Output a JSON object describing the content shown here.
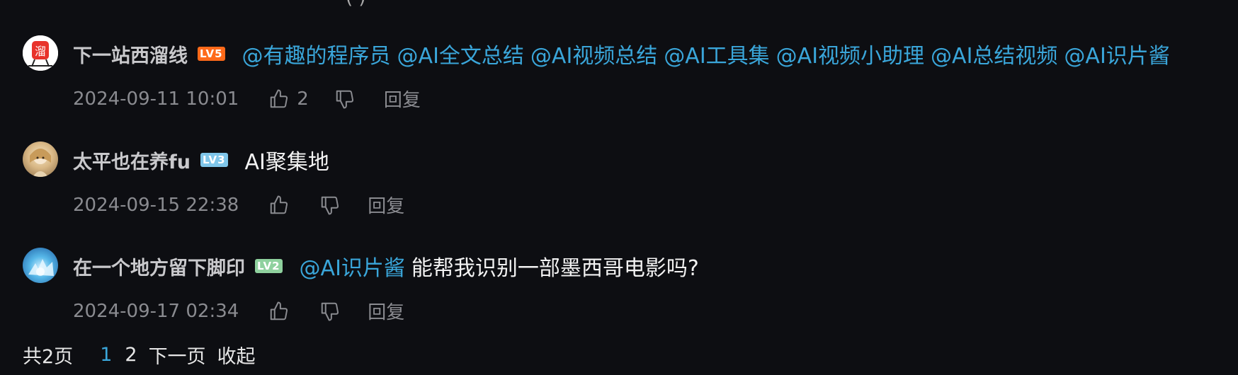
{
  "top_fragment": "( )",
  "comments": [
    {
      "username": "下一站西溜线",
      "level": "LV5",
      "level_color": "#ff6a1a",
      "avatar_icon": "subway-logo-avatar",
      "avatar_glyph": "溜",
      "mentions": [
        "@有趣的程序员",
        "@AI全文总结",
        "@AI视频总结",
        "@AI工具集",
        "@AI视频小助理",
        "@AI总结视频",
        "@AI识片酱"
      ],
      "text": "",
      "timestamp": "2024-09-11 10:01",
      "likes": "2",
      "reply_label": "回复"
    },
    {
      "username": "太平也在养fu",
      "level": "LV3",
      "level_color": "#7fc6ea",
      "avatar_icon": "anime-character-avatar",
      "mentions": [],
      "text": "AI聚集地",
      "timestamp": "2024-09-15 22:38",
      "likes": "",
      "reply_label": "回复"
    },
    {
      "username": "在一个地方留下脚印",
      "level": "LV2",
      "level_color": "#8fd19e",
      "avatar_icon": "blue-ice-avatar",
      "mentions": [
        "@AI识片酱"
      ],
      "text": "能帮我识别一部墨西哥电影吗?",
      "timestamp": "2024-09-17 02:34",
      "likes": "",
      "reply_label": "回复"
    }
  ],
  "pagination": {
    "total_label": "共2页",
    "pages": [
      "1",
      "2"
    ],
    "current_page": "1",
    "next_label": "下一页",
    "collapse_label": "收起"
  },
  "colors": {
    "background": "#0d0e12",
    "mention": "#3aa6da",
    "meta": "#8a8b90"
  }
}
